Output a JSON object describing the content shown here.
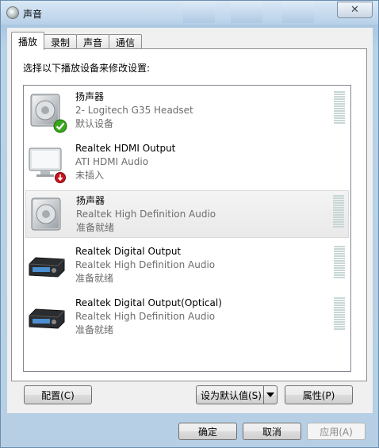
{
  "window": {
    "title": "声音",
    "close_glyph": "✕"
  },
  "tabs": [
    {
      "label": "播放",
      "active": true
    },
    {
      "label": "录制",
      "active": false
    },
    {
      "label": "声音",
      "active": false
    },
    {
      "label": "通信",
      "active": false
    }
  ],
  "instruction": "选择以下播放设备来修改设置:",
  "devices": [
    {
      "name": "扬声器",
      "description": "2- Logitech G35 Headset",
      "status": "默认设备",
      "icon": "speaker-icon",
      "badge": "default-check-icon",
      "selected": false
    },
    {
      "name": "Realtek HDMI Output",
      "description": "ATI HDMI Audio",
      "status": "未插入",
      "icon": "monitor-icon",
      "badge": "unplugged-icon",
      "selected": false
    },
    {
      "name": "扬声器",
      "description": "Realtek High Definition Audio",
      "status": "准备就绪",
      "icon": "speaker-icon",
      "badge": "",
      "selected": true
    },
    {
      "name": "Realtek Digital Output",
      "description": "Realtek High Definition Audio",
      "status": "准备就绪",
      "icon": "receiver-icon",
      "badge": "",
      "selected": false
    },
    {
      "name": "Realtek Digital Output(Optical)",
      "description": "Realtek High Definition Audio",
      "status": "准备就绪",
      "icon": "receiver-icon",
      "badge": "",
      "selected": false
    }
  ],
  "buttons": {
    "configure": "配置(C)",
    "set_default": "设为默认值(S)",
    "properties": "属性(P)",
    "ok": "确定",
    "cancel": "取消",
    "apply": "应用(A)"
  },
  "colors": {
    "check_green": "#3aa81e",
    "unplugged_red": "#c8141e",
    "meter": "#c8d7d4"
  }
}
